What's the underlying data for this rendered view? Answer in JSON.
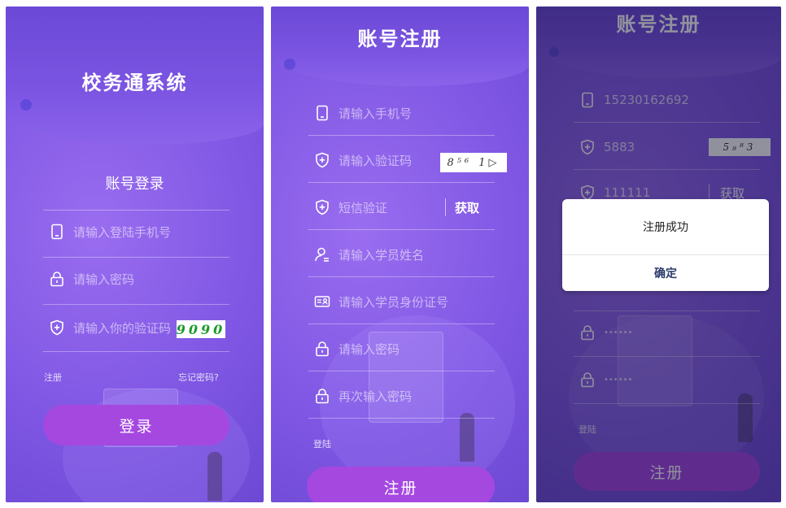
{
  "login": {
    "title": "校务通系统",
    "subtitle": "账号登录",
    "phone_placeholder": "请输入登陆手机号",
    "password_placeholder": "请输入密码",
    "captcha_placeholder": "请输入你的验证码",
    "captcha_code": "9090",
    "register_link": "注册",
    "forgot_link": "忘记密码?",
    "login_button": "登录"
  },
  "register": {
    "title": "账号注册",
    "phone_placeholder": "请输入手机号",
    "captcha_placeholder": "请输入验证码",
    "captcha_code": "8⁵⁶ 1▷",
    "sms_placeholder": "短信验证",
    "get_button": "获取",
    "name_placeholder": "请输入学员姓名",
    "id_placeholder": "请输入学员身份证号",
    "password_placeholder": "请输入密码",
    "repeat_password_placeholder": "再次输入密码",
    "login_link": "登陆",
    "register_button": "注册"
  },
  "success": {
    "title": "账号注册",
    "phone_value": "15230162692",
    "captcha_value": "5883",
    "captcha_code": "5₈⁸3",
    "sms_value": "111111",
    "get_button": "获取",
    "password_mask": "••••••",
    "repeat_password_mask": "••••••",
    "login_link": "登陆",
    "register_button": "注册",
    "dialog_message": "注册成功",
    "dialog_ok": "确定"
  },
  "colors": {
    "accent_button": "#a548e0",
    "background": "#7e56e3",
    "captcha_green": "#1a9a2a"
  }
}
